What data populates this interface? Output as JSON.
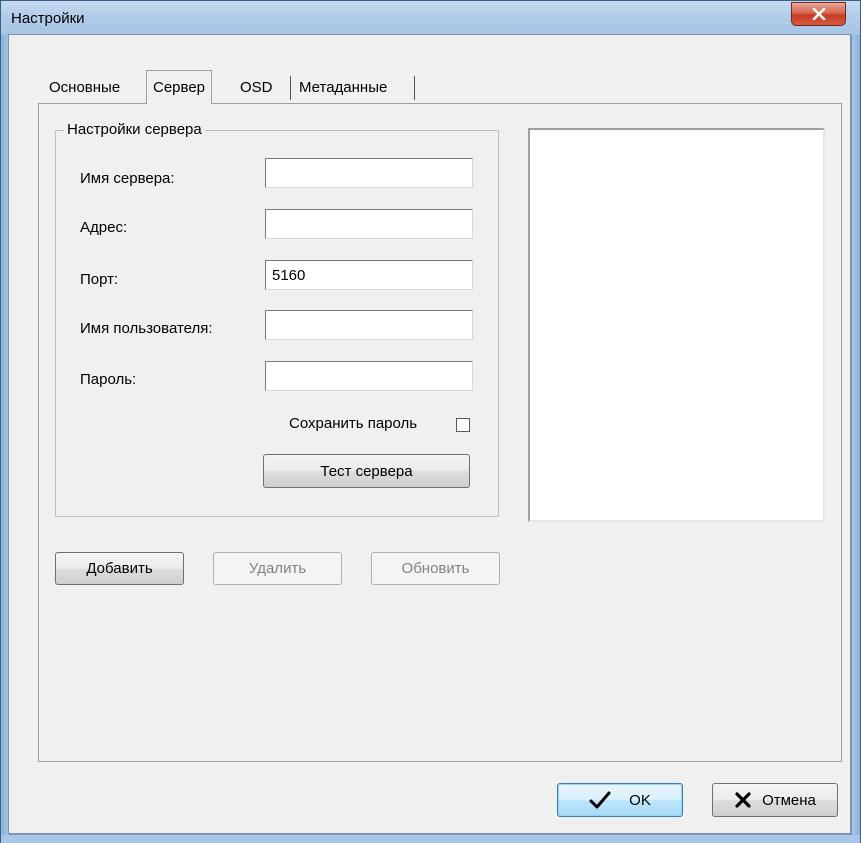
{
  "window": {
    "title": "Настройки",
    "close_icon": "close-icon"
  },
  "tabs": [
    {
      "label": "Основные",
      "active": false
    },
    {
      "label": "Сервер",
      "active": true
    },
    {
      "label": "OSD",
      "active": false
    },
    {
      "label": "Метаданные",
      "active": false
    }
  ],
  "server_group": {
    "title": "Настройки сервера",
    "fields": {
      "server_name": {
        "label": "Имя сервера:",
        "value": ""
      },
      "address": {
        "label": "Адрес:",
        "value": ""
      },
      "port": {
        "label": "Порт:",
        "value": "5160"
      },
      "username": {
        "label": "Имя пользователя:",
        "value": ""
      },
      "password": {
        "label": "Пароль:",
        "value": ""
      }
    },
    "save_password_label": "Сохранить пароль",
    "save_password_checked": false,
    "test_button": "Тест сервера"
  },
  "list_buttons": {
    "add": "Добавить",
    "delete": "Удалить",
    "refresh": "Обновить"
  },
  "dialog_buttons": {
    "ok": "OK",
    "cancel": "Отмена"
  },
  "colors": {
    "close_button": "#c43d24",
    "title_bar": "#b2cde9",
    "default_button_border": "#3c7fb1"
  }
}
